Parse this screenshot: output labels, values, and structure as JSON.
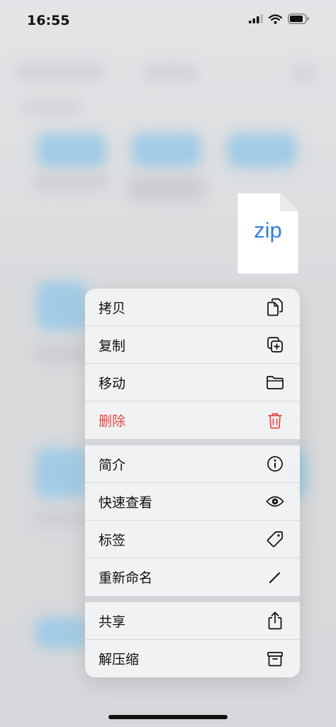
{
  "status_bar": {
    "time": "16:55"
  },
  "file": {
    "type_label": "zip"
  },
  "menu": {
    "groups": [
      [
        {
          "label": "拷贝",
          "icon": "copy-icon"
        },
        {
          "label": "复制",
          "icon": "duplicate-icon"
        },
        {
          "label": "移动",
          "icon": "folder-icon"
        },
        {
          "label": "删除",
          "icon": "trash-icon",
          "destructive": true
        }
      ],
      [
        {
          "label": "简介",
          "icon": "info-icon"
        },
        {
          "label": "快速查看",
          "icon": "eye-icon"
        },
        {
          "label": "标签",
          "icon": "tag-icon"
        },
        {
          "label": "重新命名",
          "icon": "pencil-icon"
        }
      ],
      [
        {
          "label": "共享",
          "icon": "share-icon"
        },
        {
          "label": "解压缩",
          "icon": "archive-icon"
        }
      ]
    ]
  },
  "colors": {
    "destructive": "#e5483d",
    "zip_text": "#2f7fe0"
  }
}
